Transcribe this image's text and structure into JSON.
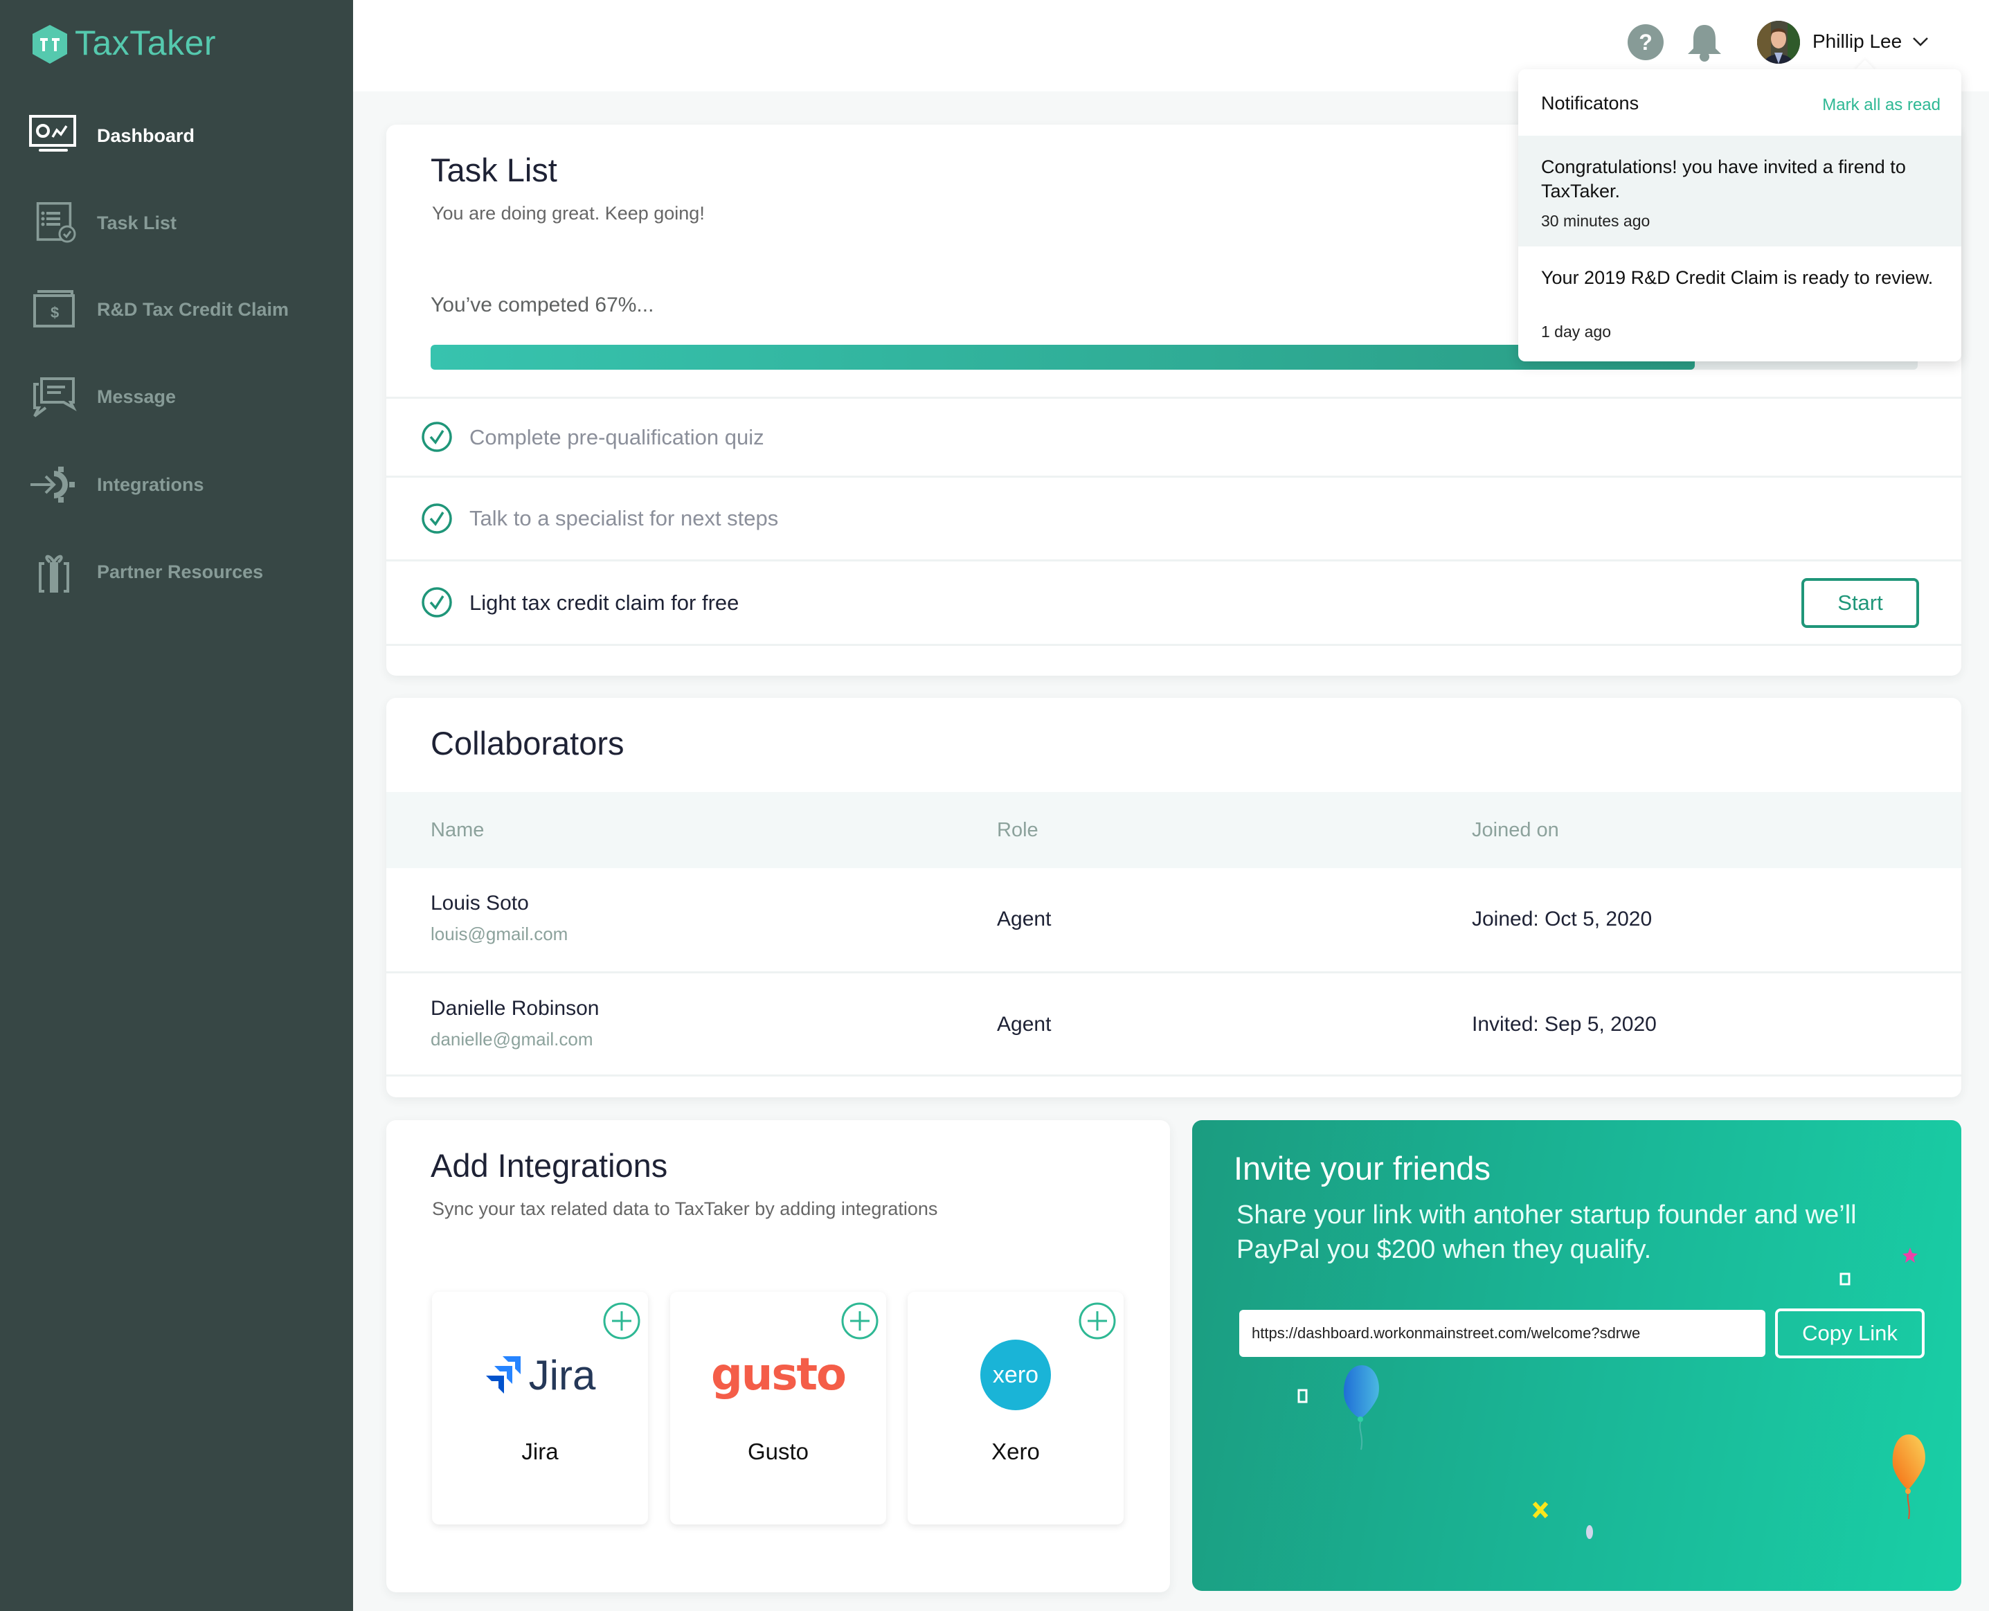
{
  "app": {
    "name": "TaxTaker",
    "brand_color": "#55c9ae",
    "accent_color": "#1f9679"
  },
  "sidebar": {
    "items": [
      {
        "label": "Dashboard",
        "icon": "dashboard-monitor-icon",
        "active": true
      },
      {
        "label": "Task List",
        "icon": "task-list-icon",
        "active": false
      },
      {
        "label": "R&D Tax Credit Claim",
        "icon": "dollar-folder-icon",
        "active": false
      },
      {
        "label": "Message",
        "icon": "chat-bubbles-icon",
        "active": false
      },
      {
        "label": "Integrations",
        "icon": "integration-gear-icon",
        "active": false
      },
      {
        "label": "Partner Resources",
        "icon": "gift-icon",
        "active": false
      }
    ]
  },
  "header": {
    "help_icon": "question-circle-icon",
    "notification_icon": "bell-icon",
    "user_name": "Phillip Lee",
    "menu_icon": "chevron-down-icon"
  },
  "notifications": {
    "title": "Notificatons",
    "mark_all": "Mark all as read",
    "items": [
      {
        "message": "Congratulations! you have invited a firend to TaxTaker.",
        "time": "30 minutes ago",
        "unread": true
      },
      {
        "message": "Your 2019 R&D Credit Claim is ready to review.",
        "time": "1 day ago",
        "unread": false
      }
    ]
  },
  "task_list": {
    "title": "Task List",
    "subtitle": "You are doing great. Keep going!",
    "progress_label": "You’ve competed 67%...",
    "progress_percent": 67,
    "progress_bar_fill_fraction": 0.85,
    "tasks": [
      {
        "label": "Complete pre-qualification quiz",
        "done": true
      },
      {
        "label": "Talk to a specialist for next steps",
        "done": true
      },
      {
        "label": "Light tax credit claim for free",
        "done": false,
        "action": "Start"
      }
    ]
  },
  "collaborators": {
    "title": "Collaborators",
    "columns": [
      "Name",
      "Role",
      "Joined on"
    ],
    "rows": [
      {
        "name": "Louis Soto",
        "email": "louis@gmail.com",
        "role": "Agent",
        "date": "Joined: Oct 5, 2020"
      },
      {
        "name": "Danielle Robinson",
        "email": "danielle@gmail.com",
        "role": "Agent",
        "date": "Invited: Sep 5, 2020"
      }
    ]
  },
  "integrations": {
    "title": "Add Integrations",
    "subtitle": "Sync your tax related data to TaxTaker by adding integrations",
    "items": [
      {
        "name": "Jira",
        "logo_text": "Jira",
        "color": "#253858"
      },
      {
        "name": "Gusto",
        "logo_text": "gusto",
        "color": "#f45d48"
      },
      {
        "name": "Xero",
        "logo_text": "xero",
        "color": "#1ab4d7"
      }
    ]
  },
  "invite": {
    "title": "Invite your friends",
    "text": "Share your link with antoher startup founder and we’ll PayPal you $200 when they qualify.",
    "link": "https://dashboard.workonmainstreet.com/welcome?sdrwe",
    "copy_label": "Copy Link"
  }
}
